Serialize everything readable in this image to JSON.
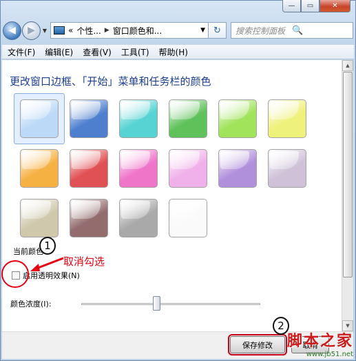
{
  "window": {
    "caption": {
      "min": "—",
      "max": "▭",
      "close": "✕"
    }
  },
  "navigation": {
    "back_glyph": "◀",
    "forward_glyph": "▶",
    "dropdown_glyph": "▼",
    "breadcrumb": [
      "«",
      "个性...",
      "窗口颜色和..."
    ],
    "breadcrumb_sep": "▶",
    "address_chevron": "▼",
    "refresh_glyph": "↻",
    "search_placeholder": "搜索控制面板",
    "search_icon": "🔍"
  },
  "menu": [
    "文件(F)",
    "编辑(E)",
    "查看(V)",
    "工具(T)",
    "帮助(H)"
  ],
  "content": {
    "heading": "更改窗口边框、「开始」菜单和任务栏的颜色",
    "swatches": [
      {
        "color": "#bcd9f7",
        "selected": true
      },
      {
        "color": "#4e7fcf"
      },
      {
        "color": "#57d3d3"
      },
      {
        "color": "#5fc15a"
      },
      {
        "color": "#a2e35c"
      },
      {
        "color": "#eef17a"
      },
      {
        "color": "#f6b143"
      },
      {
        "color": "#e05155"
      },
      {
        "color": "#ef75c9"
      },
      {
        "color": "#f0b1ea"
      },
      {
        "color": "#b190db"
      },
      {
        "color": "#cfc2d8"
      },
      {
        "color": "#cfc8ac"
      },
      {
        "color": "#936c6e"
      },
      {
        "color": "#a9a9a9"
      },
      {
        "color": "#fafafa"
      }
    ],
    "current_color_label": "当前颜色:",
    "transparency_label": "启用透明效果(N)",
    "transparency_checked": false,
    "intensity_label": "颜色浓度(I):",
    "intensity_value": 0.42
  },
  "buttons": {
    "save": "保存修改",
    "cancel": "取消"
  },
  "annotations": {
    "marker1": "1",
    "marker2": "2",
    "text": "取消勾选",
    "annotation_color": "#e60012"
  },
  "watermark": {
    "main": "脚本之家",
    "url": "www.jb51.net"
  }
}
